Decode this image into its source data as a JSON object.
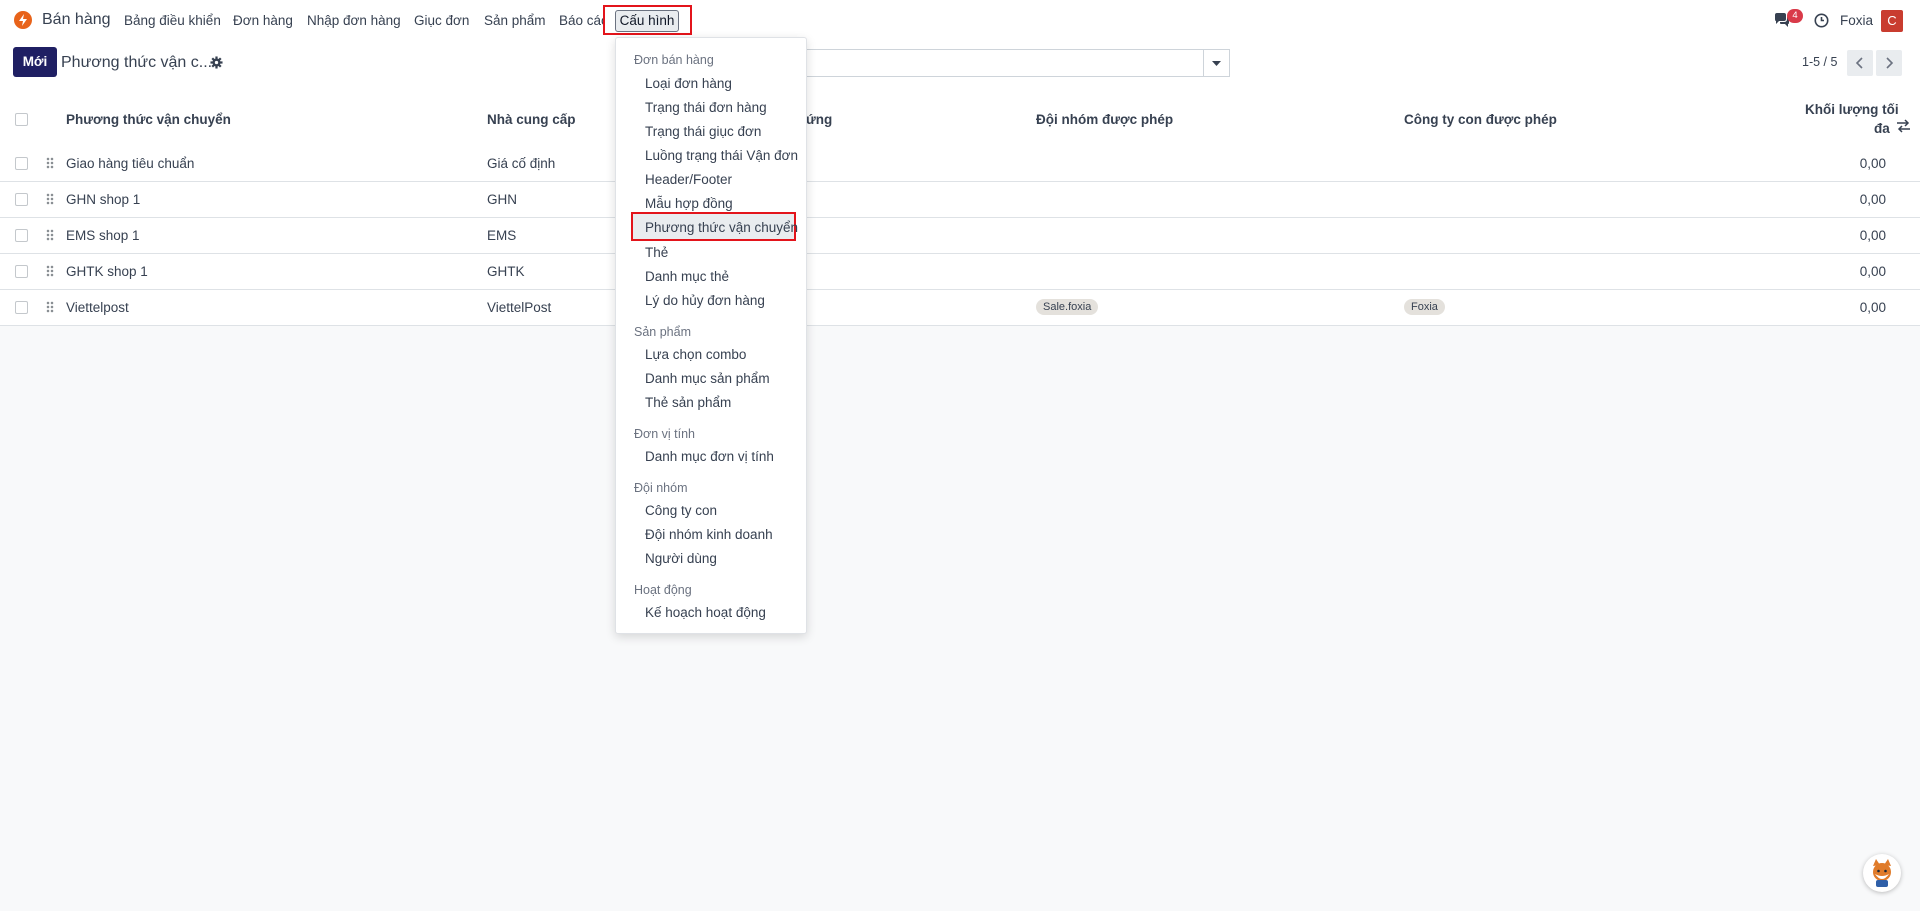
{
  "navbar": {
    "app_name": "Bán hàng",
    "menus": [
      "Bảng điều khiển",
      "Đơn hàng",
      "Nhập đơn hàng",
      "Giục đơn",
      "Sản phẩm",
      "Báo cáo"
    ],
    "active_menu": "Cấu hình",
    "messages_count": "4",
    "company": "Foxia",
    "avatar_letter": "C"
  },
  "control": {
    "new_label": "Mới",
    "breadcrumb": "Phương thức vận c...",
    "search_placeholder": "",
    "pager": "1-5 / 5"
  },
  "table": {
    "columns": [
      "Phương thức vận chuyển",
      "Nhà cung cấp",
      "ứng",
      "Đội nhóm được phép",
      "Công ty con được phép",
      "Khối lượng tối",
      "đa"
    ],
    "rows": [
      {
        "name": "Giao hàng tiêu chuẩn",
        "provider": "Giá cố định",
        "team": "",
        "company": "",
        "weight": "0,00"
      },
      {
        "name": "GHN shop 1",
        "provider": "GHN",
        "team": "",
        "company": "",
        "weight": "0,00"
      },
      {
        "name": "EMS shop 1",
        "provider": "EMS",
        "team": "",
        "company": "",
        "weight": "0,00"
      },
      {
        "name": "GHTK shop 1",
        "provider": "GHTK",
        "team": "",
        "company": "",
        "weight": "0,00"
      },
      {
        "name": "Viettelpost",
        "provider": "ViettelPost",
        "team": "Sale.foxia",
        "company": "Foxia",
        "weight": "0,00"
      }
    ]
  },
  "dropdown": {
    "sections": [
      {
        "header": "Đơn bán hàng",
        "items": [
          "Loại đơn hàng",
          "Trạng thái đơn hàng",
          "Trạng thái giục đơn",
          "Luồng trạng thái Vận đơn",
          "Header/Footer",
          "Mẫu hợp đồng",
          "Phương thức vận chuyển",
          "Thẻ",
          "Danh mục thẻ",
          "Lý do hủy đơn hàng"
        ]
      },
      {
        "header": "Sản phẩm",
        "items": [
          "Lựa chọn combo",
          "Danh mục sản phẩm",
          "Thẻ sản phẩm"
        ]
      },
      {
        "header": "Đơn vị tính",
        "items": [
          "Danh mục đơn vị tính"
        ]
      },
      {
        "header": "Đội nhóm",
        "items": [
          "Công ty con",
          "Đội nhóm kinh doanh",
          "Người dùng"
        ]
      },
      {
        "header": "Hoạt động",
        "items": [
          "Kế hoạch hoạt động"
        ]
      }
    ],
    "highlighted_item": "Phương thức vận chuyển"
  },
  "colors": {
    "primary": "#1f1f63",
    "highlight_border": "#e3141b",
    "avatar": "#c93c2f",
    "badge": "#d93a49"
  }
}
